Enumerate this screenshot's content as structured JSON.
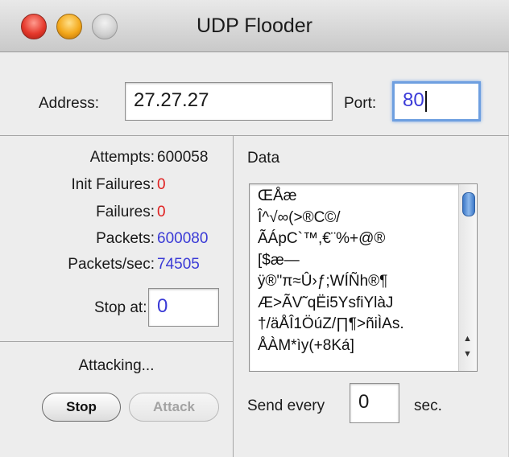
{
  "window": {
    "title": "UDP Flooder"
  },
  "address": {
    "label": "Address:",
    "value": "27.27.27"
  },
  "port": {
    "label": "Port:",
    "value": "80"
  },
  "stats": [
    {
      "label": "Attempts:",
      "value": "600058",
      "color": "#1a1a1a"
    },
    {
      "label": "Init Failures:",
      "value": "0",
      "color": "#e02020"
    },
    {
      "label": "Failures:",
      "value": "0",
      "color": "#e02020"
    },
    {
      "label": "Packets:",
      "value": "600080",
      "color": "#3a3ad6"
    },
    {
      "label": "Packets/sec:",
      "value": "74505",
      "color": "#3a3ad6"
    }
  ],
  "stop_at": {
    "label": "Stop at:",
    "value": "0"
  },
  "status": "Attacking...",
  "buttons": {
    "stop": "Stop",
    "attack": "Attack"
  },
  "data_panel": {
    "label": "Data",
    "content": "ŒÅæ\nÎ^√∞(>®C©/\nÃÁpC`™,€¨%+@®\n[$æ—\nÿ®\"π≈Û›ƒ;WÍÑh®¶\nÆ>ÃV˜qËi5YsfiYlàJ\n†/äÅÎ1ÖúZ/∏¶>ñiÌAs.\nÅÀM*ìy(+8Ká]"
  },
  "send_every": {
    "label": "Send every",
    "value": "0",
    "unit": "sec."
  },
  "colors": {
    "focus_ring": "#6e9fe0",
    "red": "#e02020",
    "blue": "#3a3ad6"
  }
}
